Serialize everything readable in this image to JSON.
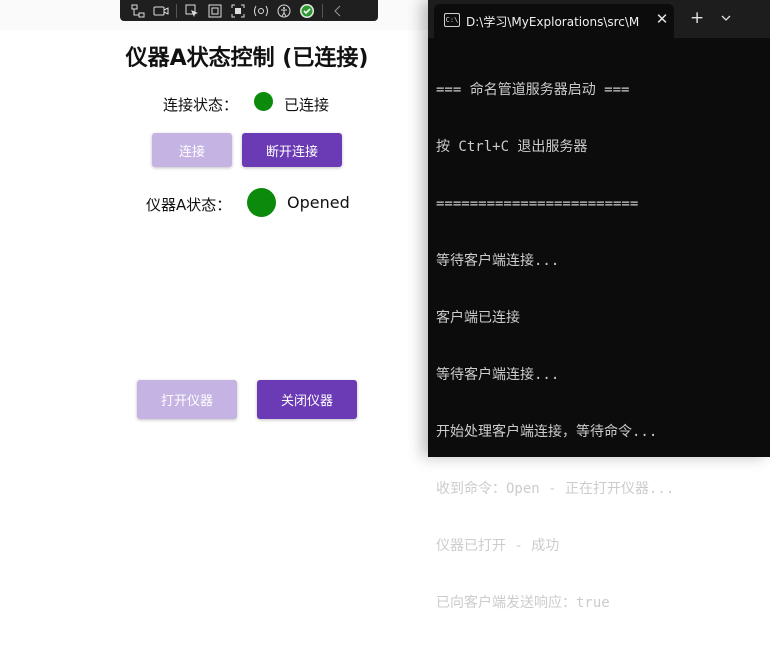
{
  "colors": {
    "status_green": "#0b8a0b",
    "button_primary": "#6a3bb5",
    "button_disabled": "#c4b3e3",
    "terminal_bg": "#0c0c0c"
  },
  "app": {
    "title": "仪器A状态控制 (已连接)",
    "connection_label": "连接状态：",
    "connection_value": "已连接",
    "connect_button": "连接",
    "disconnect_button": "断开连接",
    "instrument_label": "仪器A状态：",
    "instrument_value": "Opened",
    "open_button": "打开仪器",
    "close_button": "关闭仪器"
  },
  "terminal": {
    "tab_title": "D:\\学习\\MyExplorations\\src\\M",
    "lines": [
      "=== 命名管道服务器启动 ===",
      "按 Ctrl+C 退出服务器",
      "========================",
      "等待客户端连接...",
      "客户端已连接",
      "等待客户端连接...",
      "开始处理客户端连接，等待命令...",
      "收到命令：Open - 正在打开仪器...",
      "仪器已打开 - 成功",
      "已向客户端发送响应：true"
    ]
  }
}
